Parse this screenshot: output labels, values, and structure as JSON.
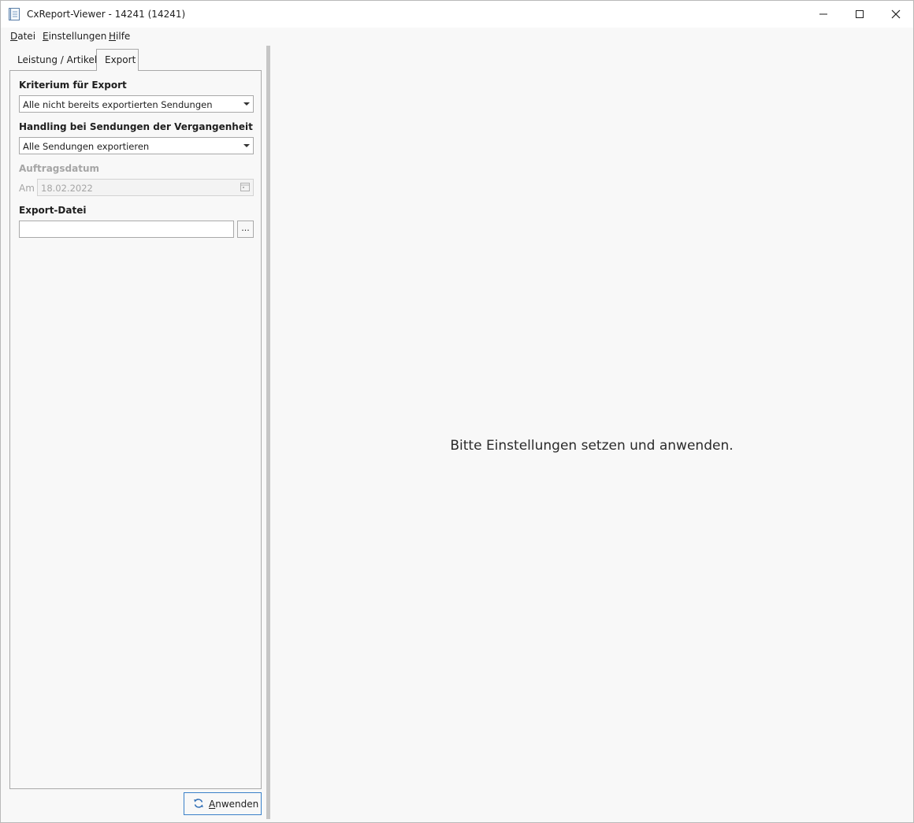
{
  "window": {
    "title": "CxReport-Viewer - 14241 (14241)",
    "controls": {
      "minimize": "minimize-icon",
      "maximize": "maximize-icon",
      "close": "close-icon"
    }
  },
  "menu": {
    "items": [
      {
        "accel": "D",
        "rest": "atei"
      },
      {
        "accel": "E",
        "rest": "instellungen"
      },
      {
        "accel": "H",
        "rest": "ilfe"
      }
    ]
  },
  "tabs": {
    "leistung": "Leistung / Artikel",
    "export": "Export"
  },
  "export_tab": {
    "kriterium_label": "Kriterium für Export",
    "kriterium_value": "Alle nicht bereits exportierten Sendungen",
    "handling_label": "Handling bei Sendungen der Vergangenheit",
    "handling_value": "Alle Sendungen exportieren",
    "auftragsdatum_label": "Auftragsdatum",
    "am_label": "Am",
    "date_value": "18.02.2022",
    "exportdatei_label": "Export-Datei",
    "exportdatei_value": "",
    "browse_label": "..."
  },
  "apply_button": {
    "accel": "A",
    "rest": "nwenden",
    "icon": "refresh-icon"
  },
  "main": {
    "hint": "Bitte Einstellungen setzen und anwenden."
  },
  "colors": {
    "accent_border": "#3a80c9",
    "background": "#f8f8f8",
    "disabled_text": "#a5a5a5"
  }
}
